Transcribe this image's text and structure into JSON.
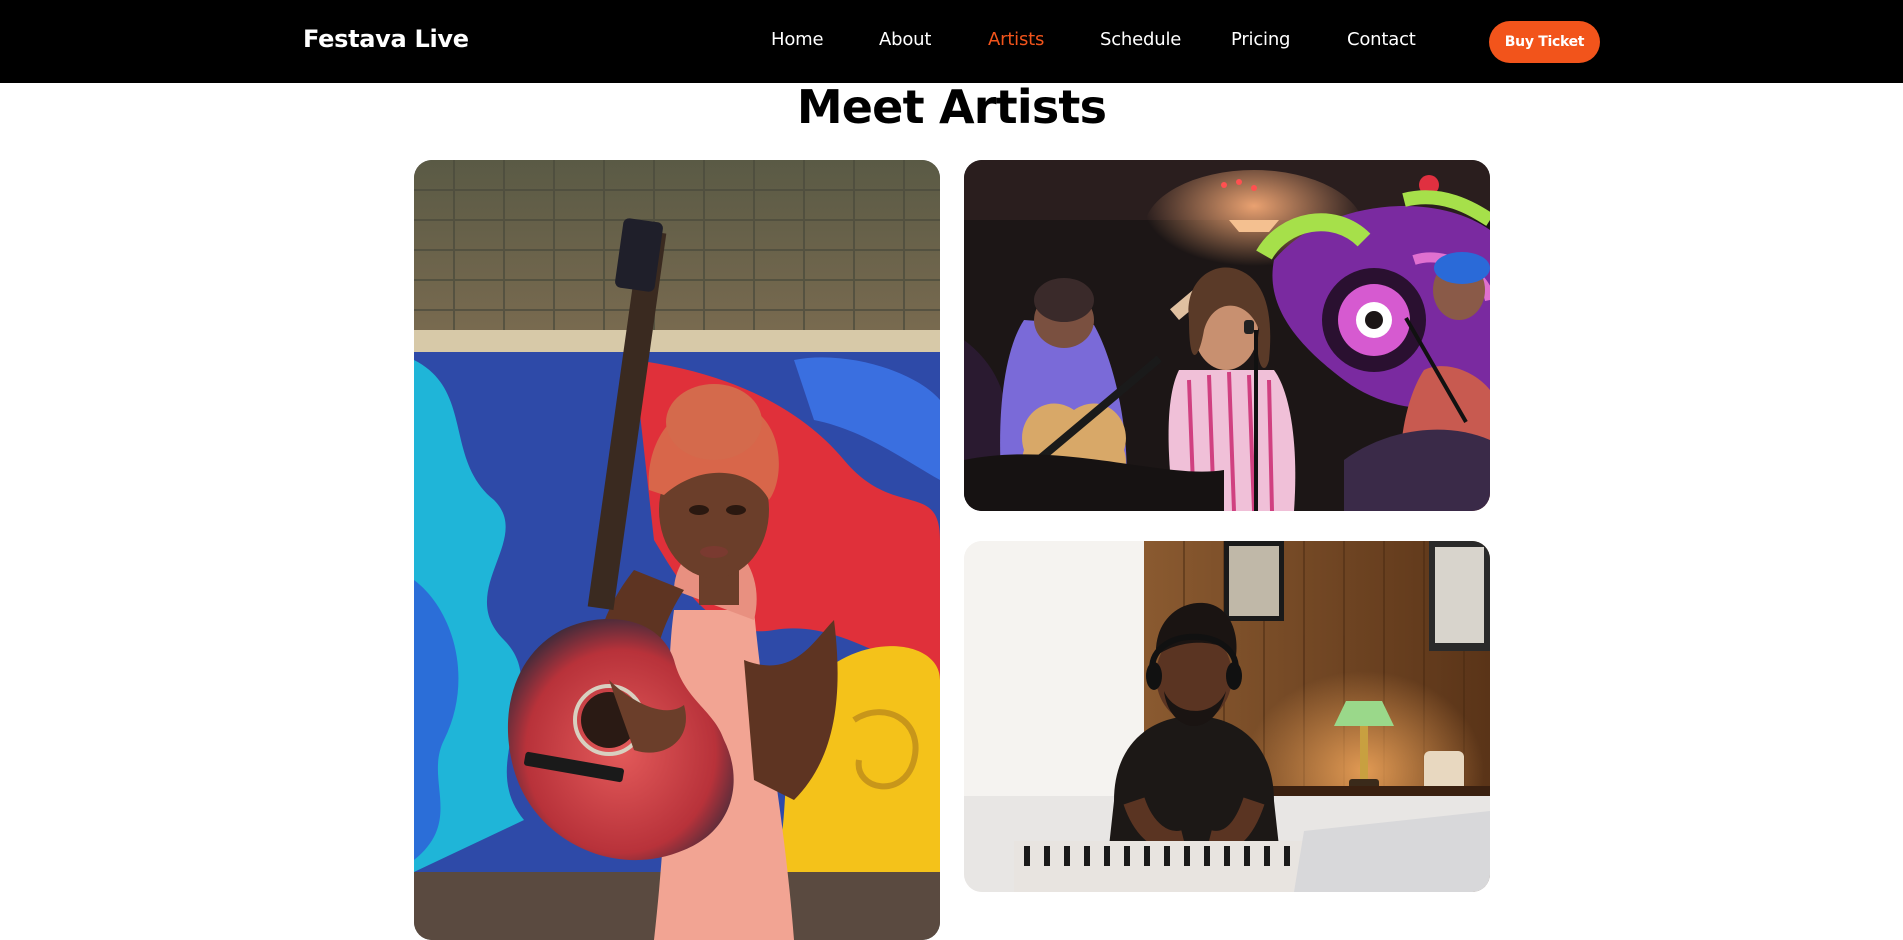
{
  "header": {
    "brand": "Festava Live",
    "nav": [
      {
        "label": "Home",
        "active": false
      },
      {
        "label": "About",
        "active": false
      },
      {
        "label": "Artists",
        "active": true
      },
      {
        "label": "Schedule",
        "active": false
      },
      {
        "label": "Pricing",
        "active": false
      },
      {
        "label": "Contact",
        "active": false
      }
    ],
    "cta_label": "Buy Ticket"
  },
  "main": {
    "title": "Meet Artists"
  },
  "colors": {
    "nav_bg": "#000000",
    "accent": "#f2541b",
    "text": "#000000",
    "page_bg": "#ffffff"
  }
}
